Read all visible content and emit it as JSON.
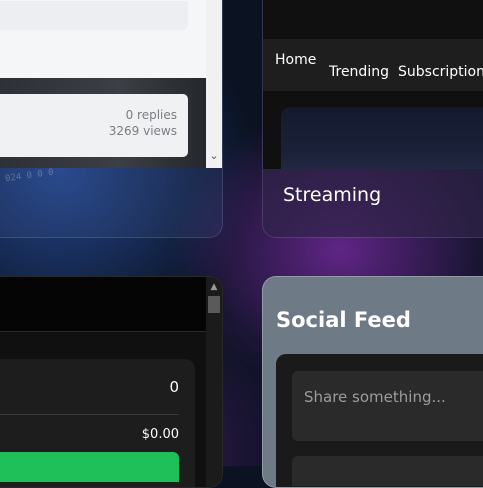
{
  "forum": {
    "replies": "0 replies",
    "views": "3269 views",
    "scroll_down_glyph": "⌄"
  },
  "streaming": {
    "nav": {
      "home": "Home",
      "trending": "Trending",
      "subscriptions": "Subscriptions"
    },
    "title": "Streaming"
  },
  "checkout": {
    "quantity": "0",
    "total": "$0.00",
    "button_color": "#1fbf5a",
    "scroll_up_glyph": "▲"
  },
  "social": {
    "title": "Social Feed",
    "composer_placeholder": "Share something..."
  }
}
